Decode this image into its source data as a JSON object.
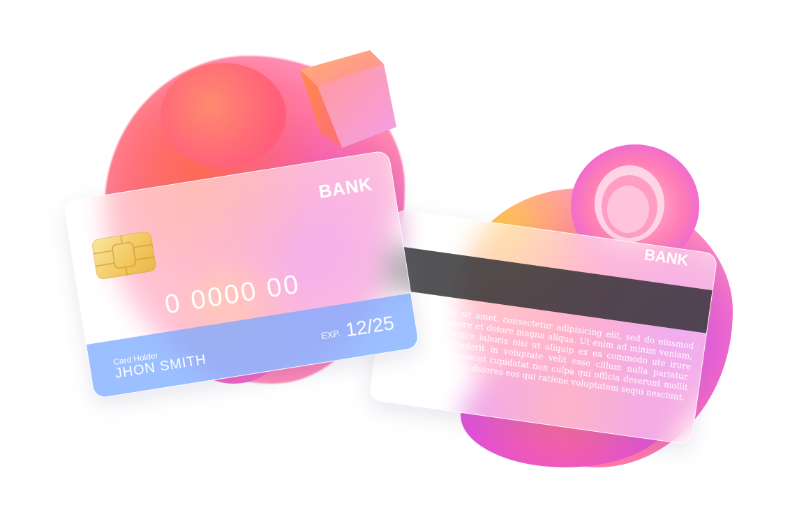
{
  "front_card": {
    "bank": "BANK",
    "number": "0 0000 00",
    "exp_label": "EXP.",
    "exp_value": "12/25",
    "holder_label": "Card Holder",
    "holder_name": "JHON SMITH"
  },
  "back_card": {
    "bank": "BANK",
    "text": "em ipsum dolor sit amet, consectetur adipisicing elit, sed do eiusmod incididunt ut labore et dolore magna aliqua. Ut enim ad minim veniam, exercitation ullamco laboris nisi ut aliquip ex ea commodo ute irure dolor in reprehenderit in voluptate velit esse cillum nulla pariatur. Excepteur sint occaecat cupidatat non culpa qui officia deserunt mollit anim id est laborum. dolores eos qui ratione voluptatem sequi nesciunt."
  },
  "colors": {
    "blob_pink": "#ff5a8c",
    "blob_orange": "#ff6a55",
    "blob_magenta": "#e84fd8",
    "stripe_blue": "#7aaaff",
    "magnetic_stripe": "#28282c",
    "chip_gold": "#f2c75e"
  }
}
